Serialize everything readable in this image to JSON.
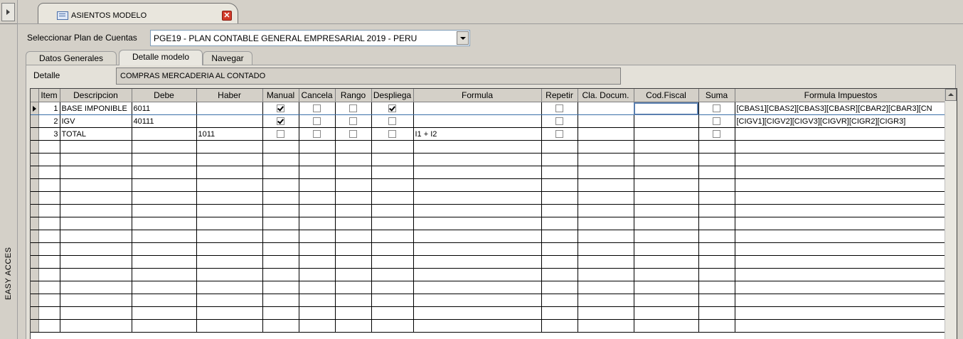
{
  "sidebar": {
    "label": "EASY ACCES"
  },
  "document_tab": {
    "title": "ASIENTOS MODELO",
    "close_icon": "close-icon"
  },
  "plan": {
    "label": "Seleccionar Plan de Cuentas",
    "selected": "PGE19 - PLAN CONTABLE GENERAL EMPRESARIAL 2019 - PERU"
  },
  "tabs": [
    {
      "label": "Datos Generales",
      "active": false
    },
    {
      "label": "Detalle modelo",
      "active": true
    },
    {
      "label": "Navegar",
      "active": false
    }
  ],
  "detalle": {
    "label": "Detalle",
    "value": "COMPRAS MERCADERIA AL CONTADO"
  },
  "grid": {
    "columns": [
      "Item",
      "Descripcion",
      "Debe",
      "Haber",
      "Manual",
      "Cancela",
      "Rango",
      "Despliega",
      "Formula",
      "Repetir",
      "Cla. Docum.",
      "Cod.Fiscal",
      "Suma",
      "Formula Impuestos"
    ],
    "rows": [
      {
        "item": "1",
        "descripcion": "BASE IMPONIBLE",
        "debe": "6011",
        "haber": "",
        "manual": true,
        "cancela": false,
        "rango": false,
        "despliega": true,
        "formula": "",
        "repetir": false,
        "cla_docum": "",
        "cod_fiscal": "",
        "suma": false,
        "formula_impuestos": "[CBAS1][CBAS2][CBAS3][CBASR][CBAR2][CBAR3][CN"
      },
      {
        "item": "2",
        "descripcion": "IGV",
        "debe": "40111",
        "haber": "",
        "manual": true,
        "cancela": false,
        "rango": false,
        "despliega": false,
        "formula": "",
        "repetir": false,
        "cla_docum": "",
        "cod_fiscal": "",
        "suma": false,
        "formula_impuestos": "[CIGV1][CIGV2][CIGV3][CIGVR][CIGR2][CIGR3]"
      },
      {
        "item": "3",
        "descripcion": "TOTAL",
        "debe": "",
        "haber": "1011",
        "manual": false,
        "cancela": false,
        "rango": false,
        "despliega": false,
        "formula": "I1 + I2",
        "repetir": false,
        "cla_docum": "",
        "cod_fiscal": "",
        "suma": false,
        "formula_impuestos": ""
      }
    ],
    "empty_rows": 15
  }
}
